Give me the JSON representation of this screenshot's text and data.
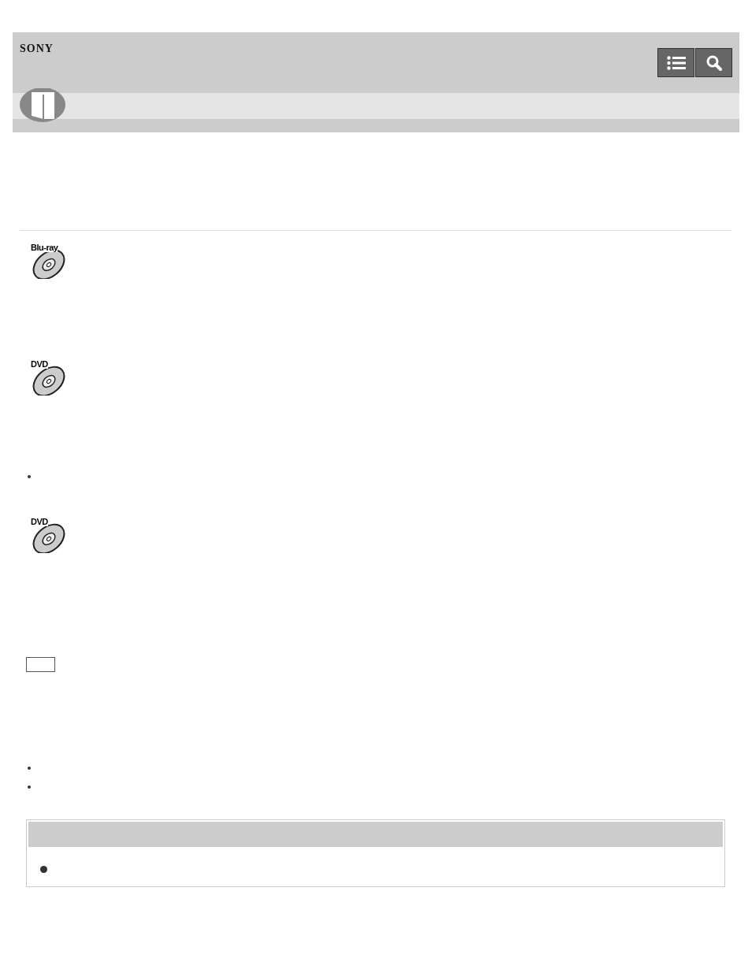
{
  "header": {
    "logo": "SONY"
  },
  "discs": [
    {
      "label": "Blu-ray"
    },
    {
      "label": "DVD"
    },
    {
      "label": "DVD"
    }
  ]
}
